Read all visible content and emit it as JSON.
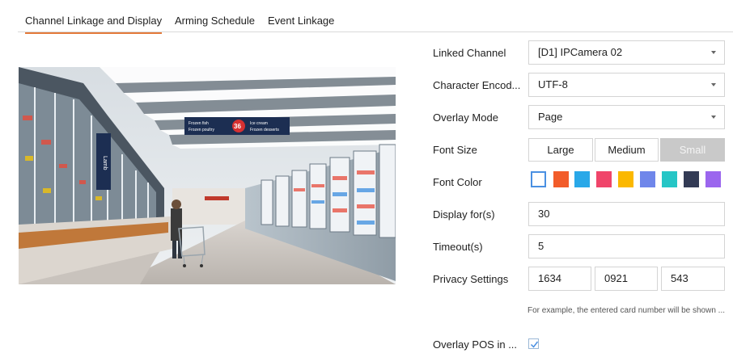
{
  "tabs": [
    {
      "label": "Channel Linkage and Display",
      "active": true
    },
    {
      "label": "Arming Schedule",
      "active": false
    },
    {
      "label": "Event Linkage",
      "active": false
    }
  ],
  "preview": {
    "signs": {
      "left": "Frozen fish",
      "left2": "Frozen poultry",
      "number": "36",
      "right": "Ice cream",
      "right2": "Frozen desserts",
      "side": "Lamb"
    }
  },
  "form": {
    "linked_channel": {
      "label": "Linked Channel",
      "value": "[D1] IPCamera 02"
    },
    "character_encoding": {
      "label": "Character Encod...",
      "value": "UTF-8"
    },
    "overlay_mode": {
      "label": "Overlay Mode",
      "value": "Page"
    },
    "font_size": {
      "label": "Font Size",
      "options": [
        "Large",
        "Medium",
        "Small"
      ],
      "disabled": "Small"
    },
    "font_color": {
      "label": "Font Color",
      "swatches": [
        "#ffffff",
        "#f25c2a",
        "#29a8e8",
        "#f0456a",
        "#fbb800",
        "#6f86ea",
        "#26c6c6",
        "#333b55",
        "#9b66ee"
      ],
      "selected": "#ffffff"
    },
    "display_for": {
      "label": "Display for(s)",
      "value": "30"
    },
    "timeout": {
      "label": "Timeout(s)",
      "value": "5"
    },
    "privacy": {
      "label": "Privacy Settings",
      "values": [
        "1634",
        "0921",
        "543"
      ]
    },
    "hint": "For example, the entered card number will be shown ...",
    "overlay_pos": {
      "label": "Overlay POS in ...",
      "checked": true
    }
  },
  "colors": {
    "accent": "#e37a3a",
    "check": "#4a90e2"
  }
}
